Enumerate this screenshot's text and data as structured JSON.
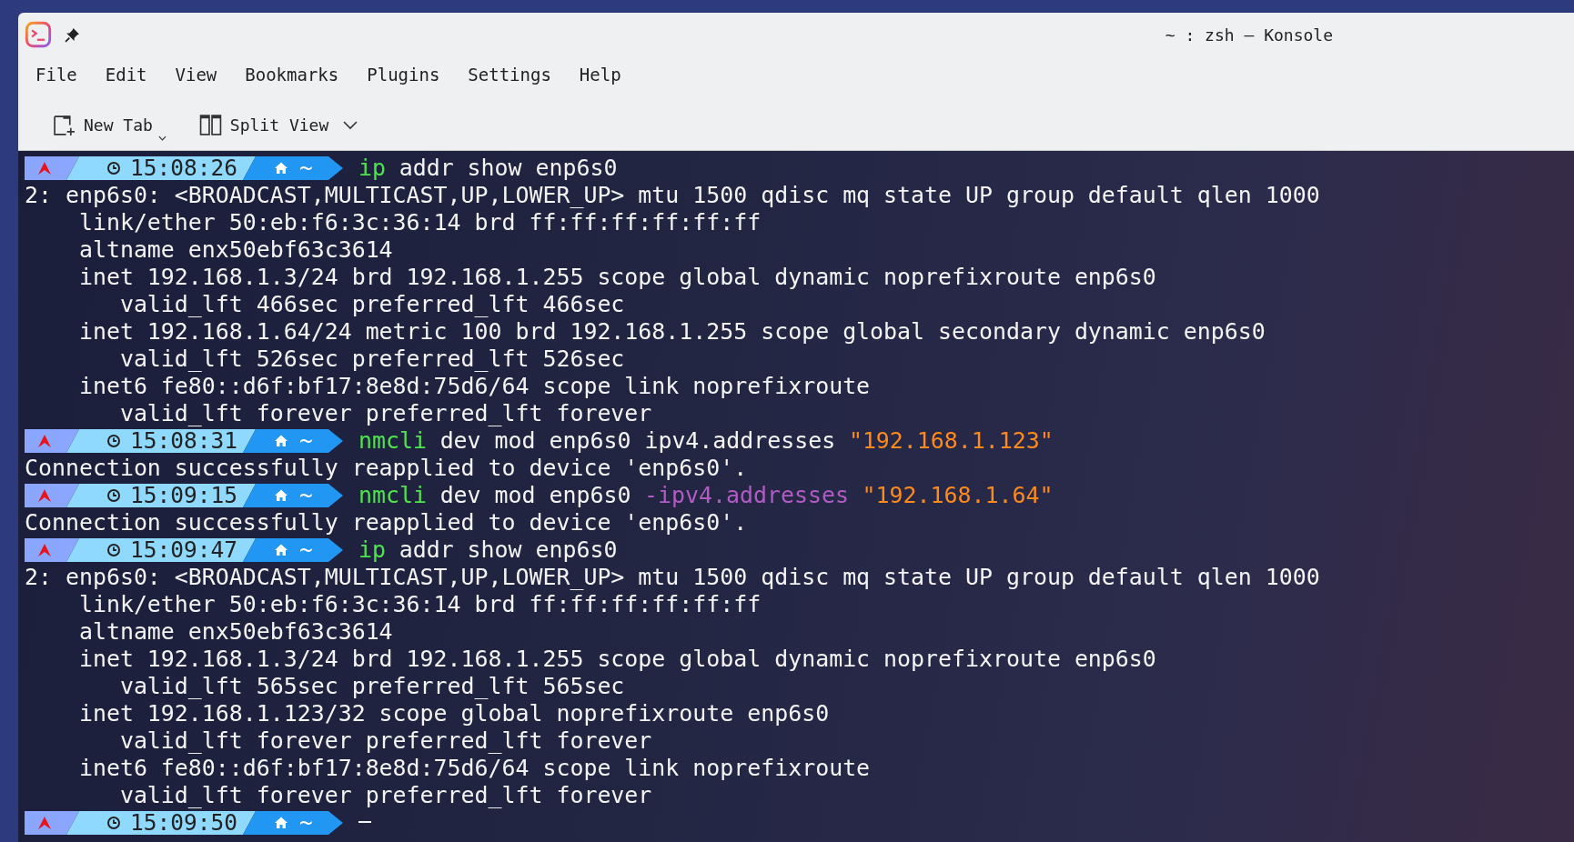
{
  "window": {
    "title": "~ : zsh — Konsole"
  },
  "menu": [
    "File",
    "Edit",
    "View",
    "Bookmarks",
    "Plugins",
    "Settings",
    "Help"
  ],
  "toolbar": [
    {
      "kind": "new-tab",
      "label": "New Tab"
    },
    {
      "kind": "split-view",
      "label": "Split View"
    }
  ],
  "terminal": {
    "lines": [
      {
        "kind": "prompt",
        "time": "15:08:26",
        "dir": "~",
        "tokens": [
          {
            "kind": "command",
            "text": "ip"
          },
          {
            "kind": "arg",
            "text": "addr show enp6s0"
          }
        ]
      },
      {
        "kind": "output",
        "text": "2: enp6s0: <BROADCAST,MULTICAST,UP,LOWER_UP> mtu 1500 qdisc mq state UP group default qlen 1000"
      },
      {
        "kind": "output",
        "text": "    link/ether 50:eb:f6:3c:36:14 brd ff:ff:ff:ff:ff:ff"
      },
      {
        "kind": "output",
        "text": "    altname enx50ebf63c3614"
      },
      {
        "kind": "output",
        "text": "    inet 192.168.1.3/24 brd 192.168.1.255 scope global dynamic noprefixroute enp6s0"
      },
      {
        "kind": "output",
        "text": "       valid_lft 466sec preferred_lft 466sec"
      },
      {
        "kind": "output",
        "text": "    inet 192.168.1.64/24 metric 100 brd 192.168.1.255 scope global secondary dynamic enp6s0"
      },
      {
        "kind": "output",
        "text": "       valid_lft 526sec preferred_lft 526sec"
      },
      {
        "kind": "output",
        "text": "    inet6 fe80::d6f:bf17:8e8d:75d6/64 scope link noprefixroute"
      },
      {
        "kind": "output",
        "text": "       valid_lft forever preferred_lft forever"
      },
      {
        "kind": "prompt",
        "time": "15:08:31",
        "dir": "~",
        "tokens": [
          {
            "kind": "command",
            "text": "nmcli"
          },
          {
            "kind": "arg",
            "text": "dev mod enp6s0 ipv4.addresses"
          },
          {
            "kind": "string",
            "text": "\"192.168.1.123\""
          }
        ]
      },
      {
        "kind": "output",
        "text": "Connection successfully reapplied to device 'enp6s0'."
      },
      {
        "kind": "prompt",
        "time": "15:09:15",
        "dir": "~",
        "tokens": [
          {
            "kind": "command",
            "text": "nmcli"
          },
          {
            "kind": "arg",
            "text": "dev mod enp6s0"
          },
          {
            "kind": "option",
            "text": "-ipv4.addresses"
          },
          {
            "kind": "string",
            "text": "\"192.168.1.64\""
          }
        ]
      },
      {
        "kind": "output",
        "text": "Connection successfully reapplied to device 'enp6s0'."
      },
      {
        "kind": "prompt",
        "time": "15:09:47",
        "dir": "~",
        "tokens": [
          {
            "kind": "command",
            "text": "ip"
          },
          {
            "kind": "arg",
            "text": "addr show enp6s0"
          }
        ]
      },
      {
        "kind": "output",
        "text": "2: enp6s0: <BROADCAST,MULTICAST,UP,LOWER_UP> mtu 1500 qdisc mq state UP group default qlen 1000"
      },
      {
        "kind": "output",
        "text": "    link/ether 50:eb:f6:3c:36:14 brd ff:ff:ff:ff:ff:ff"
      },
      {
        "kind": "output",
        "text": "    altname enx50ebf63c3614"
      },
      {
        "kind": "output",
        "text": "    inet 192.168.1.3/24 brd 192.168.1.255 scope global dynamic noprefixroute enp6s0"
      },
      {
        "kind": "output",
        "text": "       valid_lft 565sec preferred_lft 565sec"
      },
      {
        "kind": "output",
        "text": "    inet 192.168.1.123/32 scope global noprefixroute enp6s0"
      },
      {
        "kind": "output",
        "text": "       valid_lft forever preferred_lft forever"
      },
      {
        "kind": "output",
        "text": "    inet6 fe80::d6f:bf17:8e8d:75d6/64 scope link noprefixroute"
      },
      {
        "kind": "output",
        "text": "       valid_lft forever preferred_lft forever"
      },
      {
        "kind": "prompt",
        "time": "15:09:50",
        "dir": "~",
        "cursor": true
      }
    ]
  }
}
